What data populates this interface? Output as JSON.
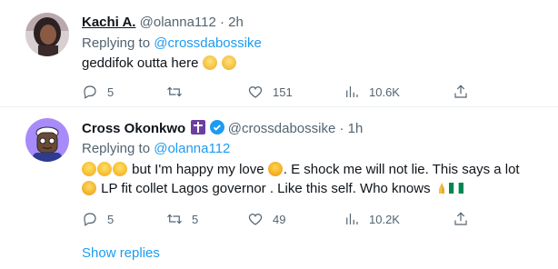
{
  "tweet1": {
    "name": "Kachi A.",
    "handle": "@olanna112",
    "sep": "·",
    "time": "2h",
    "replying_prefix": "Replying to ",
    "replying_to": "@crossdabossike",
    "text": "geddifok outta here",
    "stats": {
      "replies": "5",
      "retweets": "",
      "likes": "151",
      "views": "10.6K"
    }
  },
  "tweet2": {
    "name": "Cross Okonkwo",
    "handle": "@crossdabossike",
    "sep": "·",
    "time": "1h",
    "replying_prefix": "Replying to ",
    "replying_to": "@olanna112",
    "line1_a": " but I'm happy my love ",
    "line1_b": ". E shock me will not lie. This says a lot",
    "line2": " LP fit collet Lagos governor . Like this self. Who knows ",
    "stats": {
      "replies": "5",
      "retweets": "5",
      "likes": "49",
      "views": "10.2K"
    }
  },
  "show_replies": "Show replies",
  "colors": {
    "link": "#1d9bf0",
    "muted": "#536471",
    "verified": "#1d9bf0"
  },
  "icons": [
    "reply-icon",
    "retweet-icon",
    "like-icon",
    "views-icon",
    "share-icon",
    "verified-badge-icon",
    "cross-icon"
  ]
}
